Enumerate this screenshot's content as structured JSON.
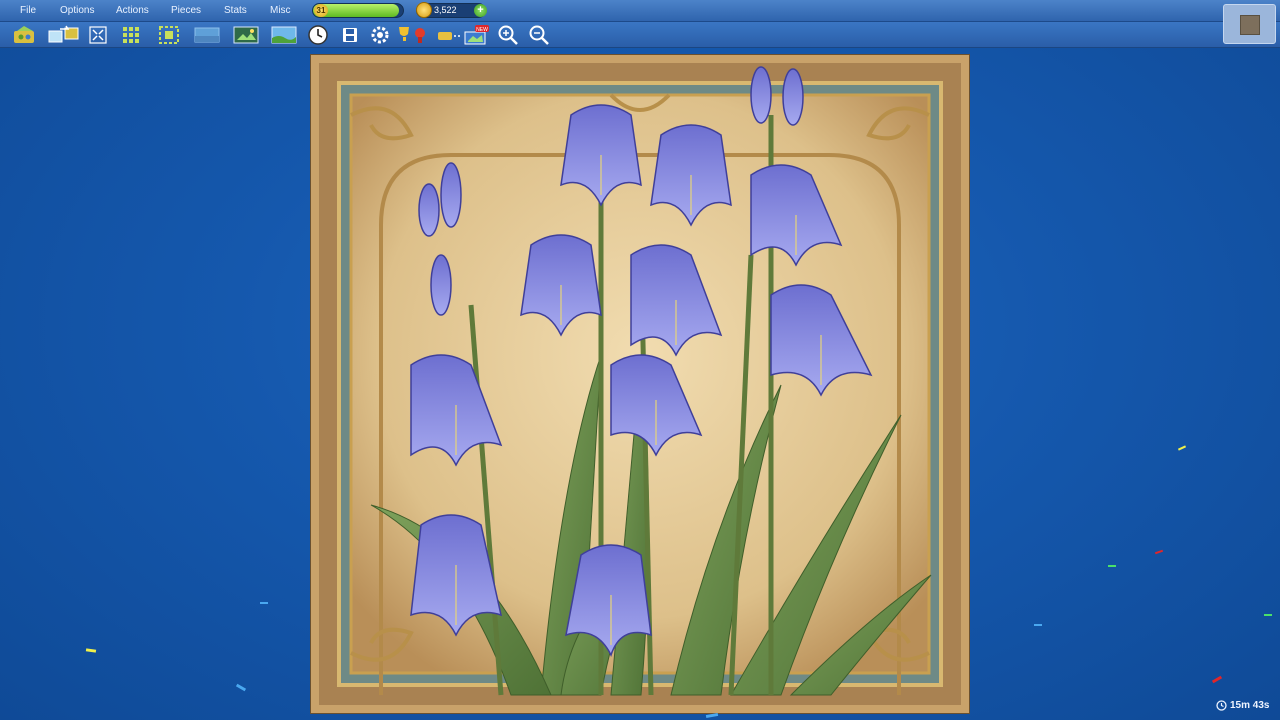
{
  "menu": {
    "items": [
      "File",
      "Options",
      "Actions",
      "Pieces",
      "Stats",
      "Misc"
    ]
  },
  "status": {
    "level": "31",
    "xp_progress": 0.95,
    "coins": "3,522"
  },
  "toolbar": {
    "icons": [
      "piece-box-icon",
      "shuffle-pieces-icon",
      "fullscreen-icon",
      "sort-edges-icon",
      "select-edges-icon",
      "background-icon",
      "preview-image-icon",
      "landscape-image-icon",
      "clock-icon",
      "save-icon",
      "settings-icon",
      "trophy-icon",
      "scroll-icon",
      "new-puzzle-icon",
      "zoom-in-icon",
      "zoom-out-icon"
    ]
  },
  "timer": {
    "value": "15m 43s"
  },
  "colors": {
    "background": "#1558ad",
    "menubar": "#3a70b8",
    "xp_fill": "#6ec92e",
    "coin": "#e0a418"
  }
}
